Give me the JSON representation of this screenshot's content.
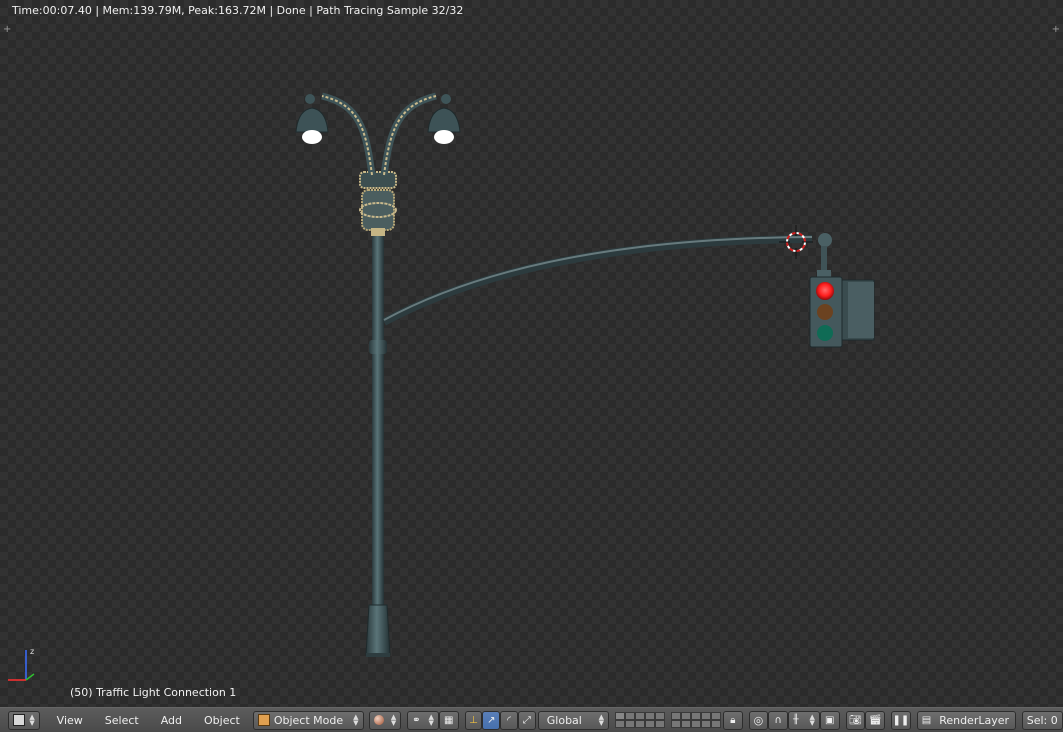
{
  "status_bar": {
    "text": "Time:00:07.40 | Mem:139.79M, Peak:163.72M | Done | Path Tracing Sample 32/32"
  },
  "viewport": {
    "object_info": "(50) Traffic Light Connection 1"
  },
  "header": {
    "editor_type_icon": "3d-view-icon",
    "menus": {
      "view": "View",
      "select": "Select",
      "add": "Add",
      "object": "Object"
    },
    "mode": {
      "label": "Object Mode",
      "icon": "cube-icon"
    },
    "shading_icon": "sphere-icon",
    "pivot_icon": "pivot-icon",
    "orientation": {
      "label": "Global"
    },
    "render_layer": {
      "label": "RenderLayer",
      "icon": "render-layer-icon"
    },
    "selection_count": "Sel: 0"
  },
  "colors": {
    "traffic_red": "#ff1e1e",
    "traffic_amber": "#6b4220",
    "traffic_green": "#0f6b55",
    "pole_color": "#3f5357",
    "gold_trim": "#b8a878",
    "header_bg": "#555555",
    "active_button": "#5680c2"
  }
}
